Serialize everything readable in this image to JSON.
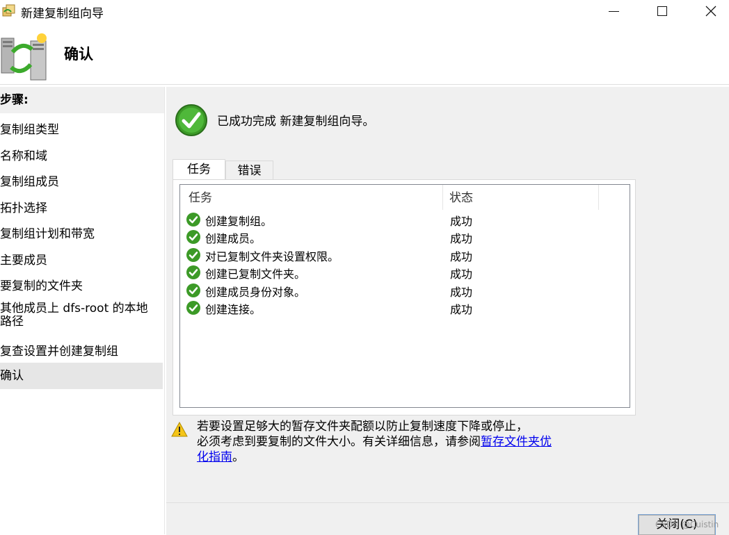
{
  "window": {
    "title": "新建复制组向导",
    "minimize_icon": "minimize-icon",
    "maximize_icon": "maximize-icon",
    "close_icon": "close-icon"
  },
  "header": {
    "title": "确认"
  },
  "steps": {
    "label": "步骤:",
    "items": [
      "复制组类型",
      "名称和域",
      "复制组成员",
      "拓扑选择",
      "复制组计划和带宽",
      "主要成员",
      "要复制的文件夹",
      "其他成员上 dfs-root 的本地路径",
      "复查设置并创建复制组",
      "确认"
    ],
    "active_index": 9
  },
  "main": {
    "success_message": "已成功完成 新建复制组向导。",
    "tabs": [
      "任务",
      "错误"
    ],
    "columns": [
      "任务",
      "状态"
    ],
    "rows": [
      {
        "task": "创建复制组。",
        "status": "成功"
      },
      {
        "task": "创建成员。",
        "status": "成功"
      },
      {
        "task": "对已复制文件夹设置权限。",
        "status": "成功"
      },
      {
        "task": "创建已复制文件夹。",
        "status": "成功"
      },
      {
        "task": "创建成员身份对象。",
        "status": "成功"
      },
      {
        "task": "创建连接。",
        "status": "成功"
      }
    ],
    "warning_text_line1": "若要设置足够大的暂存文件夹配额以防止复制速度下降或停止，",
    "warning_text_line2": "必须考虑到要复制的文件大小。有关详细信息，请参阅",
    "warning_link": "暂存文件夹优化指南",
    "warning_end": "。"
  },
  "footer": {
    "close_label": "关闭(C)",
    "watermark": "CSDN @Cuistin"
  },
  "colors": {
    "link": "#0000ee",
    "panel_bg": "#f0f0f0",
    "success_green": "#3c9a27"
  }
}
